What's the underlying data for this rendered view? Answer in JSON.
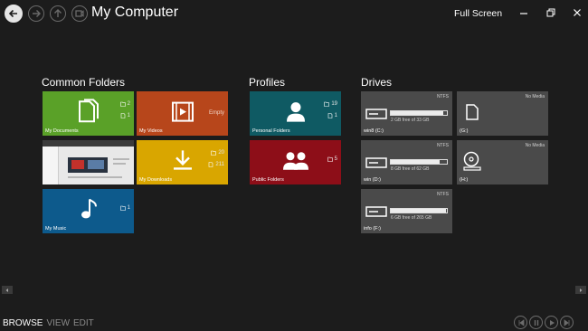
{
  "header": {
    "title": "My Computer",
    "fullscreen_label": "Full Screen"
  },
  "groups": {
    "common_folders": "Common Folders",
    "profiles": "Profiles",
    "drives": "Drives"
  },
  "common_folders": [
    {
      "label": "My Documents",
      "folders": "2",
      "files": "1",
      "color": "#5aa128"
    },
    {
      "label": "My Videos",
      "status": "Empty",
      "color": "#b7461b"
    },
    {
      "label": "My Pictures preview",
      "color": "#e8e8e8"
    },
    {
      "label": "My Downloads",
      "folders": "20",
      "files": "211",
      "color": "#d9a600"
    },
    {
      "label": "My Music",
      "folders": "1",
      "color": "#0d5a8c"
    }
  ],
  "profiles": [
    {
      "label": "Personal Folders",
      "folders": "19",
      "files": "1",
      "color": "#0f5a63"
    },
    {
      "label": "Public Folders",
      "folders": "5",
      "color": "#8d0e18"
    }
  ],
  "drives": [
    {
      "label": "win8 (C:)",
      "fs": "NTFS",
      "free": "2 GB free of 33 GB",
      "used_fraction": 0.94
    },
    {
      "label": "(G:)",
      "fs": "No Media"
    },
    {
      "label": "win (D:)",
      "fs": "NTFS",
      "free": "8 GB free of 62 GB",
      "used_fraction": 0.87
    },
    {
      "label": "(H:)",
      "fs": "No Media"
    },
    {
      "label": "info (F:)",
      "fs": "NTFS",
      "free": "6 GB free of 265 GB",
      "used_fraction": 0.98
    }
  ],
  "bottom": {
    "browse": "BROWSE",
    "view": "VIEW",
    "edit": "EDIT"
  },
  "icons": {
    "back": "back-arrow-icon",
    "forward": "forward-arrow-icon",
    "up": "up-arrow-icon",
    "view": "view-icon"
  }
}
